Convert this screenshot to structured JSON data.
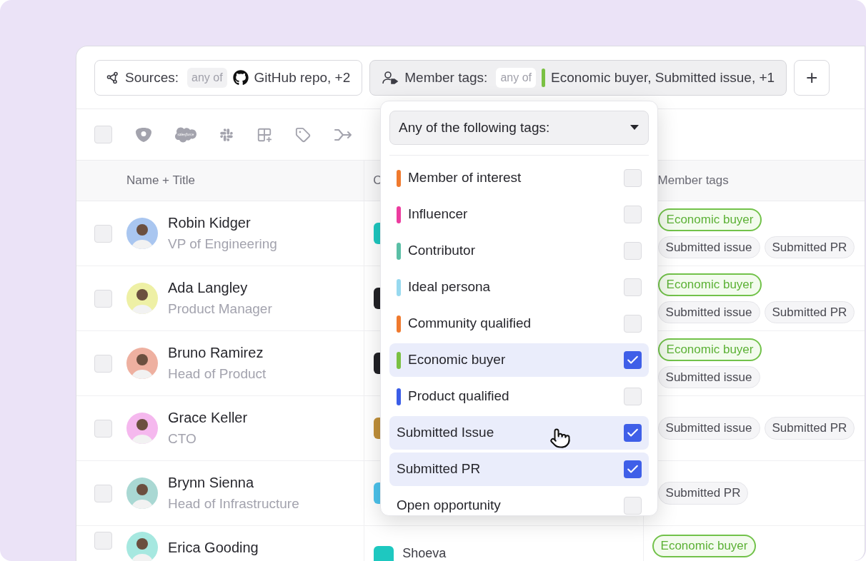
{
  "filters": [
    {
      "kind": "sources",
      "label": "Sources:",
      "operator": "any of",
      "value": "GitHub repo, +2"
    },
    {
      "kind": "member_tags",
      "label": "Member tags:",
      "operator": "any of",
      "color": "#7ac043",
      "value": "Economic buyer, Submitted issue, +1"
    }
  ],
  "add_button": "+",
  "select_all": {
    "checked": false
  },
  "columns": [
    "Name + Title",
    "C",
    "Member tags"
  ],
  "rows": [
    {
      "checked": false,
      "name": "Robin Kidger",
      "title": "VP of Engineering",
      "avatar": {
        "color": "#a9c6f0"
      },
      "company": {
        "color": "#1ec8c0"
      },
      "tag_lines": [
        {
          "tags": [
            {
              "label": "Economic buyer",
              "kind": "highlight"
            }
          ]
        },
        {
          "tags": [
            {
              "label": "Submitted issue",
              "kind": "plain"
            },
            {
              "label": "Submitted PR",
              "kind": "plain"
            }
          ]
        }
      ]
    },
    {
      "checked": false,
      "name": "Ada Langley",
      "title": "Product Manager",
      "avatar": {
        "color": "#eef0a5"
      },
      "company": {
        "color": "#222226"
      },
      "tag_lines": [
        {
          "tags": [
            {
              "label": "Economic buyer",
              "kind": "highlight"
            }
          ]
        },
        {
          "tags": [
            {
              "label": "Submitted issue",
              "kind": "plain"
            },
            {
              "label": "Submitted PR",
              "kind": "plain"
            }
          ]
        }
      ]
    },
    {
      "checked": false,
      "name": "Bruno Ramirez",
      "title": "Head of Product",
      "avatar": {
        "color": "#eeb0a0"
      },
      "company": {
        "color": "#222226"
      },
      "tag_lines": [
        {
          "tags": [
            {
              "label": "Economic buyer",
              "kind": "highlight"
            }
          ]
        },
        {
          "tags": [
            {
              "label": "Submitted issue",
              "kind": "plain"
            }
          ]
        }
      ]
    },
    {
      "checked": false,
      "name": "Grace Keller",
      "title": "CTO",
      "avatar": {
        "color": "#f5b8ee"
      },
      "company": {
        "color": "#c0903a"
      },
      "tag_lines": [
        {
          "tags": [
            {
              "label": "Submitted issue",
              "kind": "plain"
            },
            {
              "label": "Submitted PR",
              "kind": "plain"
            }
          ]
        }
      ]
    },
    {
      "checked": false,
      "name": "Brynn Sienna",
      "title": "Head of Infrastructure",
      "avatar": {
        "color": "#a9d8d3"
      },
      "company": {
        "color": "#4cc3ec"
      },
      "tag_lines": [
        {
          "tags": [
            {
              "label": "Submitted PR",
              "kind": "plain"
            }
          ]
        }
      ]
    },
    {
      "checked": false,
      "name": "Erica Gooding",
      "avatar": {
        "color": "#a6e8e0"
      },
      "company": {
        "color": "#1ec8c0",
        "name": "Shoeva"
      },
      "tag_lines": [
        {
          "tags": [
            {
              "label": "Economic buyer",
              "kind": "highlight"
            }
          ]
        }
      ]
    }
  ],
  "dropdown": {
    "select": "Any of the following tags:",
    "items": [
      {
        "label": "Member of interest",
        "color": "#f07a2e",
        "checked": false
      },
      {
        "label": "Influencer",
        "color": "#ec3c9f",
        "checked": false
      },
      {
        "label": "Contributor",
        "color": "#5bbfa6",
        "checked": false
      },
      {
        "label": "Ideal persona",
        "color": "#97d9ef",
        "checked": false
      },
      {
        "label": "Community qualified",
        "color": "#f07a2e",
        "checked": false
      },
      {
        "label": "Economic buyer",
        "color": "#7ac043",
        "checked": true
      },
      {
        "label": "Product qualified",
        "color": "#3b5de7",
        "checked": false
      },
      {
        "label": "Submitted Issue",
        "checked": true
      },
      {
        "label": "Submitted PR",
        "checked": true
      },
      {
        "label": "Open opportunity",
        "checked": false
      }
    ]
  }
}
